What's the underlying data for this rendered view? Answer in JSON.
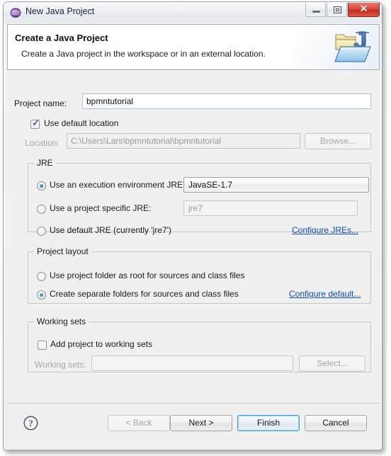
{
  "window": {
    "title": "New Java Project",
    "app_icon": "eclipse-sphere-icon",
    "minimize_label": "Minimize",
    "maximize_label": "Maximize",
    "close_label": "Close",
    "close_glyph": "✕"
  },
  "banner": {
    "title": "Create a Java Project",
    "description": "Create a Java project in the workspace or in an external location.",
    "icon": "java-project-folder-icon"
  },
  "form": {
    "project_name_label": "Project name:",
    "project_name_value": "bpmntutorial",
    "project_name_placeholder": "",
    "use_default_location_label": "Use default location",
    "use_default_location_checked": true,
    "location_label": "Location:",
    "location_value": "C:\\Users\\Lars\\bpmntutorial\\bpmntutorial",
    "location_disabled": true,
    "browse_label": "Browse..."
  },
  "jre_group": {
    "title": "JRE",
    "execution_env_radio_label": "Use an execution environment JRE:",
    "execution_env_selected": true,
    "execution_env_value": "JavaSE-1.7",
    "project_specific_radio_label": "Use a project specific JRE:",
    "project_specific_selected": false,
    "project_specific_value": "jre7",
    "default_jre_radio_label": "Use default JRE (currently 'jre7')",
    "default_jre_selected": false,
    "configure_jres_link": "Configure JREs..."
  },
  "layout_group": {
    "title": "Project layout",
    "root_radio_label": "Use project folder as root for sources and class files",
    "root_selected": false,
    "separate_radio_label": "Create separate folders for sources and class files",
    "separate_selected": true,
    "configure_default_link": "Configure default..."
  },
  "working_sets_group": {
    "title": "Working sets",
    "add_checkbox_label": "Add project to working sets",
    "add_checked": false,
    "working_sets_label": "Working sets:",
    "working_sets_value": "",
    "select_label": "Select..."
  },
  "buttonbar": {
    "help_icon": "help-question-icon",
    "back_label": "< Back",
    "back_disabled": true,
    "next_label": "Next >",
    "finish_label": "Finish",
    "finish_is_default": true,
    "cancel_label": "Cancel"
  },
  "colors": {
    "dialog_bg": "#f0f0f0",
    "banner_bg": "#ffffff",
    "link": "#0e4cc4",
    "close_button": "#c32a1c",
    "default_button_border": "#3c9fd4",
    "eclipse_purple": "#7e4e9c",
    "disabled_text": "#a6a6a6"
  }
}
